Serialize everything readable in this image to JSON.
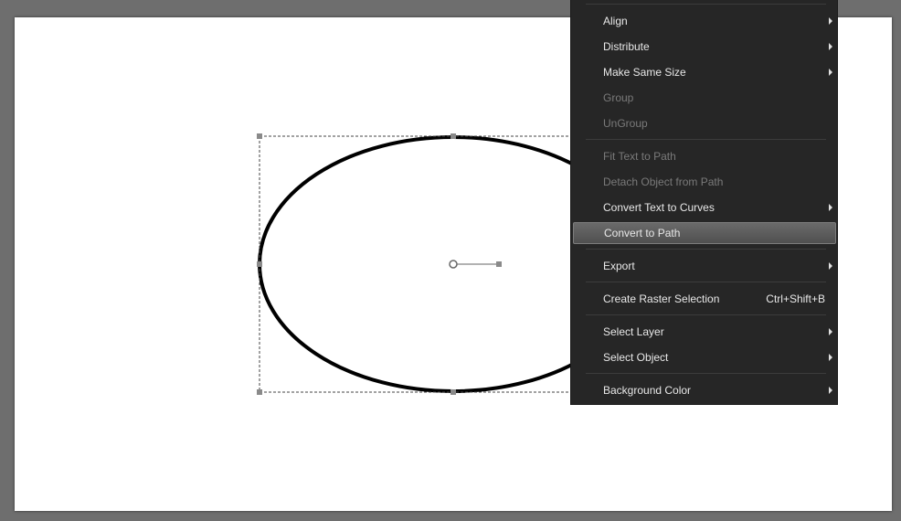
{
  "context_menu": {
    "items": [
      {
        "label": "Align",
        "submenu": true,
        "enabled": true
      },
      {
        "label": "Distribute",
        "submenu": true,
        "enabled": true
      },
      {
        "label": "Make Same Size",
        "submenu": true,
        "enabled": true
      },
      {
        "label": "Group",
        "submenu": false,
        "enabled": false
      },
      {
        "label": "UnGroup",
        "submenu": false,
        "enabled": false
      },
      {
        "label": "Fit Text to Path",
        "submenu": false,
        "enabled": false
      },
      {
        "label": "Detach Object from Path",
        "submenu": false,
        "enabled": false
      },
      {
        "label": "Convert Text to Curves",
        "submenu": true,
        "enabled": true
      },
      {
        "label": "Convert to Path",
        "submenu": false,
        "enabled": true,
        "highlighted": true
      },
      {
        "label": "Export",
        "submenu": true,
        "enabled": true
      },
      {
        "label": "Create Raster Selection",
        "submenu": false,
        "enabled": true,
        "shortcut": "Ctrl+Shift+B"
      },
      {
        "label": "Select Layer",
        "submenu": true,
        "enabled": true
      },
      {
        "label": "Select Object",
        "submenu": true,
        "enabled": true
      },
      {
        "label": "Background Color",
        "submenu": true,
        "enabled": true
      }
    ]
  },
  "colors": {
    "workspace": "#6e6e6e",
    "canvas": "#ffffff",
    "menu_background": "#262626",
    "menu_text": "#e8e8e8",
    "menu_text_disabled": "#7a7a7a",
    "ellipse_stroke": "#000000"
  }
}
